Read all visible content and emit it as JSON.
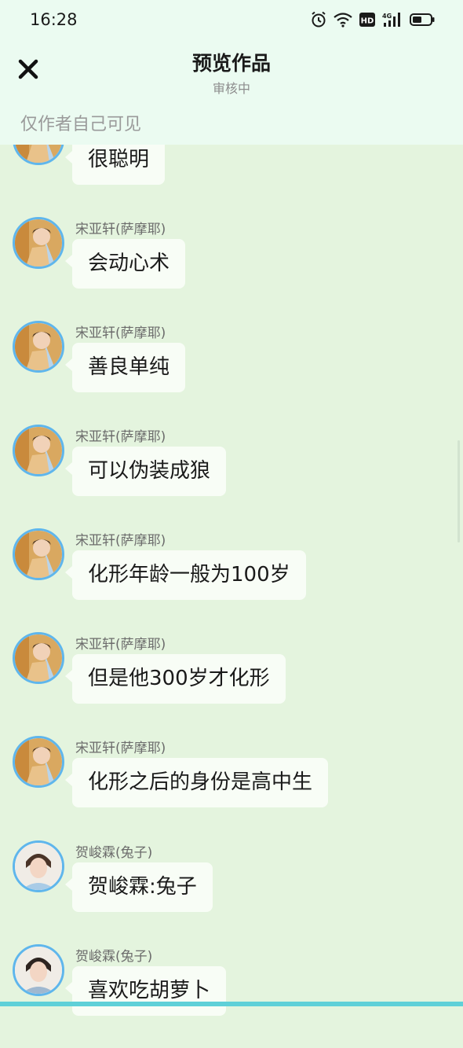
{
  "status_bar": {
    "time": "16:28",
    "icons": [
      "alarm-icon",
      "wifi-icon",
      "hd-icon",
      "signal-4g-icon",
      "battery-icon"
    ],
    "hd_label": "HD",
    "network_label": "4G"
  },
  "header": {
    "title": "预览作品",
    "subtitle": "审核中",
    "close_icon": "close-icon",
    "visibility_note": "仅作者自己可见"
  },
  "colors": {
    "header_bg": "#ebfbf1",
    "chat_bg": "#e4f4de",
    "bubble_bg": "#f8fdf6",
    "avatar_border": "#5fb6ec",
    "bottom_accent": "#5fd0d8"
  },
  "messages": [
    {
      "sender": "",
      "text": "很聪明",
      "avatar": "character-avatar-1"
    },
    {
      "sender": "宋亚轩(萨摩耶)",
      "text": "会动心术",
      "avatar": "character-avatar-1"
    },
    {
      "sender": "宋亚轩(萨摩耶)",
      "text": "善良单纯",
      "avatar": "character-avatar-1"
    },
    {
      "sender": "宋亚轩(萨摩耶)",
      "text": "可以伪装成狼",
      "avatar": "character-avatar-1"
    },
    {
      "sender": "宋亚轩(萨摩耶)",
      "text": "化形年龄一般为100岁",
      "avatar": "character-avatar-1"
    },
    {
      "sender": "宋亚轩(萨摩耶)",
      "text": "但是他300岁才化形",
      "avatar": "character-avatar-1"
    },
    {
      "sender": "宋亚轩(萨摩耶)",
      "text": "化形之后的身份是高中生",
      "avatar": "character-avatar-1"
    },
    {
      "sender": "贺峻霖(兔子)",
      "text": "贺峻霖:兔子",
      "avatar": "character-avatar-2"
    },
    {
      "sender": "贺峻霖(兔子)",
      "text": "喜欢吃胡萝卜",
      "avatar": "character-avatar-2"
    }
  ]
}
